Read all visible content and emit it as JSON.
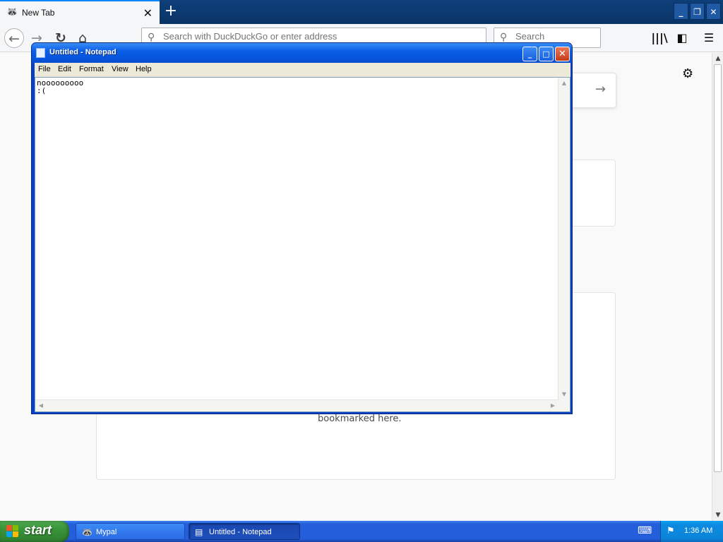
{
  "browser": {
    "tab": {
      "title": "New Tab",
      "favicon": "mypal-favicon-icon"
    },
    "urlbar": {
      "placeholder": "Search with DuckDuckGo or enter address"
    },
    "searchbar": {
      "placeholder": "Search"
    },
    "newtab": {
      "bookmark_text": "bookmarked here."
    },
    "icons": [
      "back-arrow-icon",
      "forward-arrow-icon",
      "reload-icon",
      "home-icon",
      "library-icon",
      "sidebar-icon",
      "hamburger-menu-icon",
      "gear-icon"
    ]
  },
  "notepad": {
    "title": "Untitled - Notepad",
    "menu": [
      "File",
      "Edit",
      "Format",
      "View",
      "Help"
    ],
    "content": "nooooooooo\n:("
  },
  "taskbar": {
    "start_label": "start",
    "tasks": [
      {
        "label": "Mypal",
        "active": false
      },
      {
        "label": "Untitled - Notepad",
        "active": true
      }
    ],
    "clock": "1:36 AM"
  },
  "colors": {
    "xp_title_blue": "#0654dc",
    "taskbar_blue": "#245edb",
    "start_green": "#3a943a",
    "firefox_tabbar": "#0e3f7a"
  }
}
